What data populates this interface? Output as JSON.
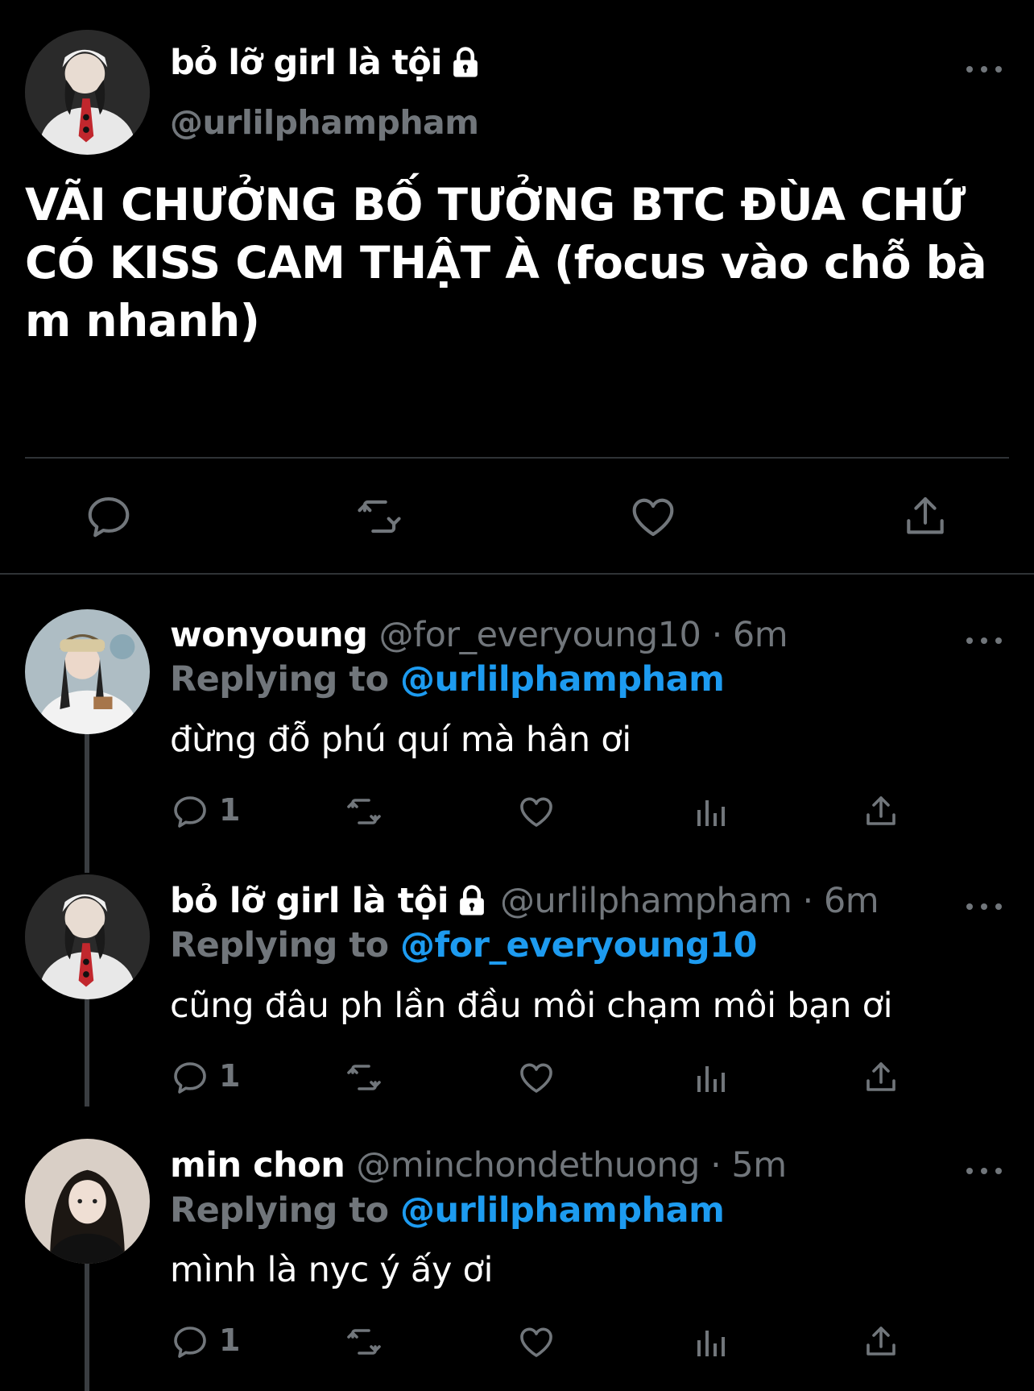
{
  "main_tweet": {
    "display_name": "bỏ lỡ girl là tội",
    "handle": "@urlilphampham",
    "text": "VÃI CHƯỞNG BỐ TƯỞNG BTC ĐÙA CHỨ CÓ KISS CAM THẬT À (focus vào chỗ bà m nhanh)",
    "icons": [
      "lock-icon",
      "reply-icon",
      "retweet-icon",
      "like-icon",
      "share-icon",
      "more-icon"
    ]
  },
  "replies": [
    {
      "display_name": "wonyoung",
      "meta": "@for_everyoung10 · 6m",
      "replying_label": "Replying to",
      "replying_to": "@urlilphampham",
      "text": "đừng đỗ phú quí mà hân ơi",
      "reply_count": "1"
    },
    {
      "display_name": "bỏ lỡ girl là tội",
      "meta": "@urlilphampham · 6m",
      "replying_label": "Replying to",
      "replying_to": "@for_everyoung10",
      "text": "cũng đâu ph lần đầu môi chạm môi bạn ơi",
      "reply_count": "1"
    },
    {
      "display_name": "min chon",
      "meta": "@minchondethuong · 5m",
      "replying_label": "Replying to",
      "replying_to": "@urlilphampham",
      "text": "mình là nyc ý ấy ơi",
      "reply_count": "1"
    }
  ],
  "colors": {
    "background": "#000000",
    "secondary_text": "#71767b",
    "link": "#1d9bf0",
    "divider": "#2f3336"
  }
}
